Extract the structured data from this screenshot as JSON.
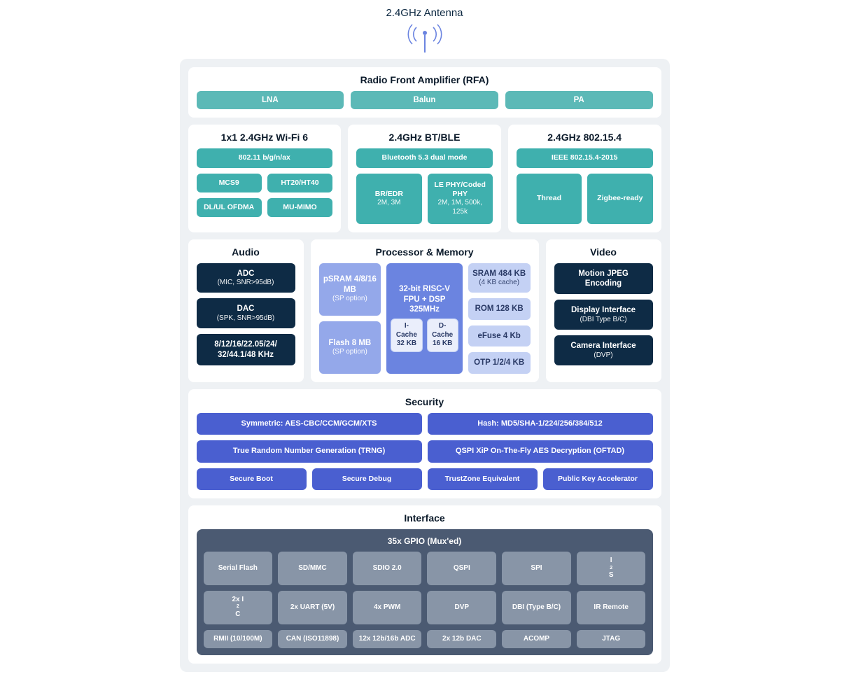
{
  "antenna": {
    "label": "2.4GHz Antenna"
  },
  "rfa": {
    "title": "Radio Front Amplifier (RFA)",
    "items": [
      "LNA",
      "Balun",
      "PA"
    ]
  },
  "wireless": [
    {
      "title": "1x1 2.4GHz Wi-Fi 6",
      "wide": "802.11 b/g/n/ax",
      "rows": [
        [
          "MCS9",
          "HT20/HT40"
        ],
        [
          "DL/UL OFDMA",
          "MU-MIMO"
        ]
      ]
    },
    {
      "title": "2.4GHz BT/BLE",
      "wide": "Bluetooth 5.3 dual mode",
      "pair": [
        {
          "l1": "BR/EDR",
          "l2": "2M, 3M"
        },
        {
          "l1": "LE PHY/Coded PHY",
          "l2": "2M, 1M, 500k, 125k"
        }
      ]
    },
    {
      "title": "2.4GHz 802.15.4",
      "wide": "IEEE 802.15.4-2015",
      "rows": [
        [
          "Thread",
          "Zigbee-ready"
        ]
      ]
    }
  ],
  "audio": {
    "title": "Audio",
    "items": [
      {
        "l1": "ADC",
        "l2": "(MIC, SNR>95dB)"
      },
      {
        "l1": "DAC",
        "l2": "(SPK, SNR>95dB)"
      },
      {
        "l1": "8/12/16/22.05/24/",
        "l2": "32/44.1/48 KHz"
      }
    ]
  },
  "processor": {
    "title": "Processor & Memory",
    "left": [
      {
        "l1": "pSRAM 4/8/16 MB",
        "l2": "(SP option)"
      },
      {
        "l1": "Flash 8 MB",
        "l2": "(SP option)"
      }
    ],
    "core": {
      "l1": "32-bit RISC-V",
      "l2": "FPU + DSP",
      "l3": "325MHz",
      "caches": [
        {
          "l1": "I-Cache",
          "l2": "32 KB"
        },
        {
          "l1": "D-Cache",
          "l2": "16 KB"
        }
      ]
    },
    "right": [
      {
        "l1": "SRAM 484 KB",
        "l2": "(4 KB cache)"
      },
      {
        "l1": "ROM 128 KB"
      },
      {
        "l1": "eFuse 4 Kb"
      },
      {
        "l1": "OTP 1/2/4 KB"
      }
    ]
  },
  "video": {
    "title": "Video",
    "items": [
      {
        "l1": "Motion JPEG",
        "l2": "Encoding"
      },
      {
        "l1": "Display Interface",
        "l2": "(DBI Type B/C)"
      },
      {
        "l1": "Camera Interface",
        "l2": "(DVP)"
      }
    ]
  },
  "security": {
    "title": "Security",
    "row1": [
      "Symmetric: AES-CBC/CCM/GCM/XTS",
      "Hash: MD5/SHA-1/224/256/384/512"
    ],
    "row2": [
      "True Random Number Generation (TRNG)",
      "QSPI XiP On-The-Fly AES Decryption (OFTAD)"
    ],
    "row3": [
      "Secure Boot",
      "Secure Debug",
      "TrustZone Equivalent",
      "Public Key Accelerator"
    ]
  },
  "interface": {
    "title": "Interface",
    "inner_title": "35x GPIO (Mux'ed)",
    "rows": [
      [
        "Serial Flash",
        "SD/MMC",
        "SDIO 2.0",
        "QSPI",
        "SPI",
        "I²S"
      ],
      [
        "2x I²C",
        "2x UART (5V)",
        "4x PWM",
        "DVP",
        "DBI (Type B/C)",
        "IR Remote"
      ],
      [
        "RMII (10/100M)",
        "CAN (ISO11898)",
        "12x 12b/16b ADC",
        "2x 12b DAC",
        "ACOMP",
        "JTAG"
      ]
    ]
  }
}
